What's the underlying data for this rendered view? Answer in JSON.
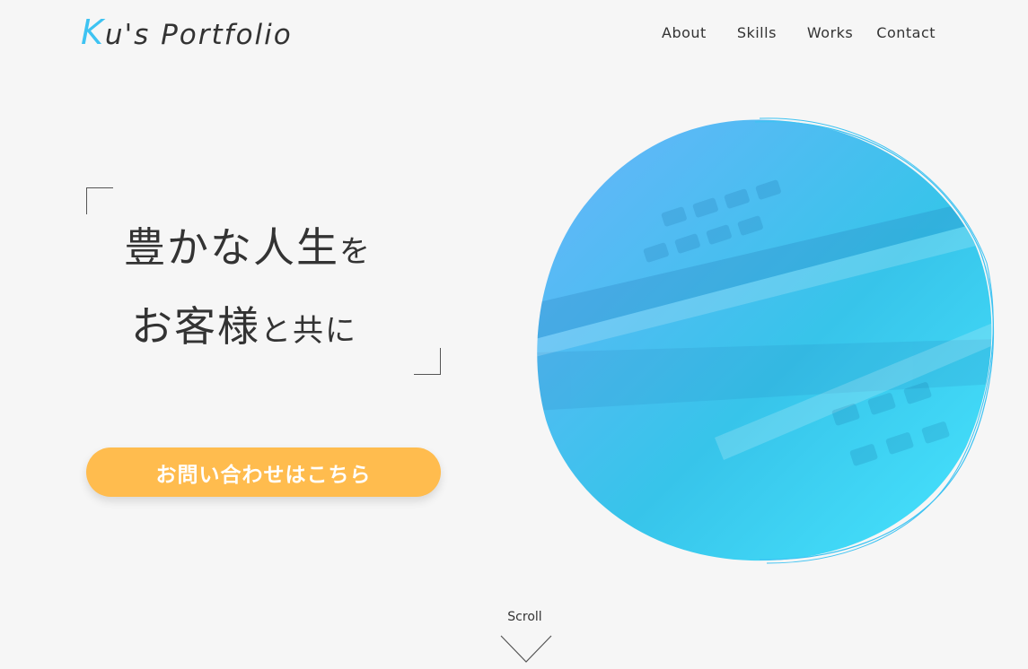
{
  "header": {
    "logo_first": "K",
    "logo_rest": "u's Portfolio",
    "nav": [
      "About",
      "Skills",
      "Works",
      "Contact"
    ]
  },
  "hero": {
    "line1_main": "豊かな人生",
    "line1_small": "を",
    "line2_a": "お客様",
    "line2_b": "と",
    "line2_c": "共",
    "line2_d": "に",
    "cta_label": "お問い合わせはこちら"
  },
  "scroll": {
    "label": "Scroll"
  },
  "colors": {
    "accent": "#3ec3f2",
    "cta": "#ffbc4e",
    "background": "#f6f6f6"
  }
}
